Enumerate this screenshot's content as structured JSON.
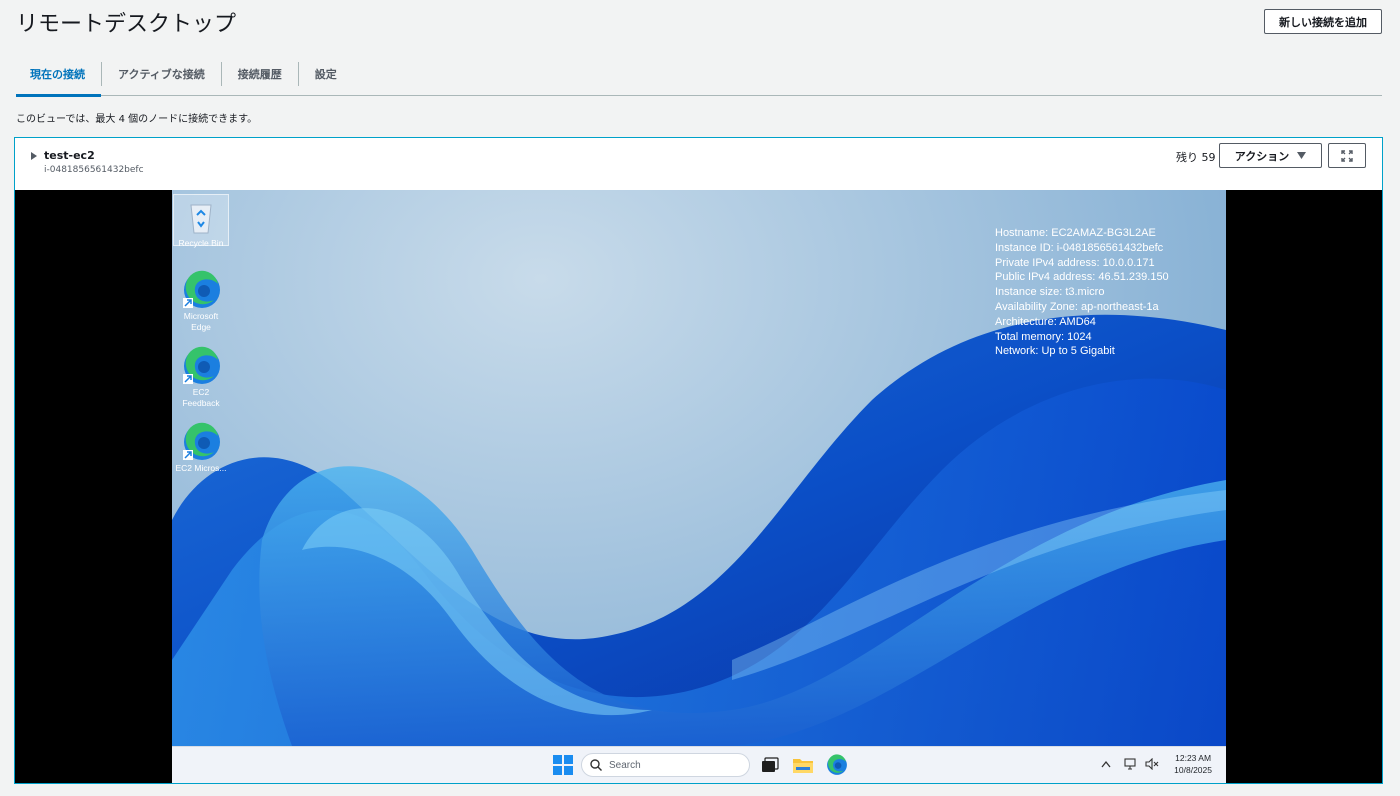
{
  "header": {
    "title": "リモートデスクトップ",
    "add_connection_label": "新しい接続を追加"
  },
  "tabs": [
    {
      "label": "現在の接続",
      "active": true
    },
    {
      "label": "アクティブな接続",
      "active": false
    },
    {
      "label": "接続履歴",
      "active": false
    },
    {
      "label": "設定",
      "active": false
    }
  ],
  "info_text": "このビューでは、最大 4 個のノードに接続できます。",
  "session": {
    "instance_name": "test-ec2",
    "instance_id": "i-0481856561432befc",
    "remaining": "残り 59 分",
    "action_label": "アクション",
    "fullscreen_icon": "expand-icon"
  },
  "desktop": {
    "icons": [
      {
        "label": "Recycle Bin",
        "icon": "recycle-bin-icon"
      },
      {
        "label": "Microsoft Edge",
        "icon": "edge-icon"
      },
      {
        "label": "EC2 Feedback",
        "icon": "edge-icon"
      },
      {
        "label": "EC2 Micros...",
        "icon": "edge-icon"
      }
    ],
    "sysinfo": [
      "Hostname: EC2AMAZ-BG3L2AE",
      "Instance ID: i-0481856561432befc",
      "Private IPv4 address: 10.0.0.171",
      "Public IPv4 address: 46.51.239.150",
      "Instance size: t3.micro",
      "Availability Zone: ap-northeast-1a",
      "Architecture: AMD64",
      "Total memory: 1024",
      "Network: Up to 5 Gigabit"
    ],
    "taskbar": {
      "search_placeholder": "Search",
      "time": "12:23 AM",
      "date": "10/8/2025"
    }
  },
  "colors": {
    "accent": "#0073bb",
    "panel_border": "#00a1c9",
    "background": "#f2f3f3"
  }
}
